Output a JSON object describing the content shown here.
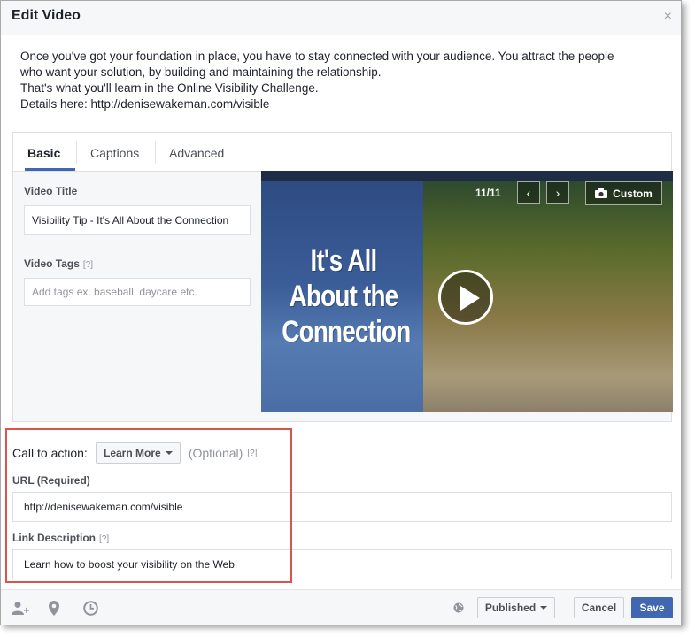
{
  "dialog": {
    "title": "Edit Video",
    "close_glyph": "×"
  },
  "description": [
    "Once you've got your foundation in place, you have to stay connected with your audience. You attract the people",
    "who want your solution, by building and maintaining the relationship.",
    "That's what you'll learn in the Online Visibility Challenge.",
    "Details here: http://denisewakeman.com/visible"
  ],
  "tabs": [
    {
      "label": "Basic",
      "active": true
    },
    {
      "label": "Captions",
      "active": false
    },
    {
      "label": "Advanced",
      "active": false
    }
  ],
  "form": {
    "video_title_label": "Video Title",
    "video_title_value": "Visibility Tip - It's All About the Connection",
    "video_tags_label": "Video Tags",
    "video_tags_help": "[?]",
    "video_tags_placeholder": "Add tags ex. baseball, daycare etc."
  },
  "video": {
    "thumbnail_text": "It's All About the Connection",
    "counter": "11/11",
    "prev_glyph": "‹",
    "next_glyph": "›",
    "custom_label": "Custom"
  },
  "cta": {
    "label": "Call to action:",
    "button_label": "Learn More",
    "optional_text": "(Optional)",
    "help": "[?]",
    "url_label": "URL (Required)",
    "url_value": "http://denisewakeman.com/visible",
    "link_desc_label": "Link Description",
    "link_desc_help": "[?]",
    "link_desc_value": "Learn how to boost your visibility on the Web!"
  },
  "footer": {
    "icons": [
      "tag-people-icon",
      "location-icon",
      "schedule-clock-icon",
      "globe-icon"
    ],
    "published_label": "Published",
    "cancel_label": "Cancel",
    "save_label": "Save"
  },
  "colors": {
    "accent": "#4267b2",
    "highlight_border": "#d9534f",
    "header_bg": "#f6f7f9"
  }
}
